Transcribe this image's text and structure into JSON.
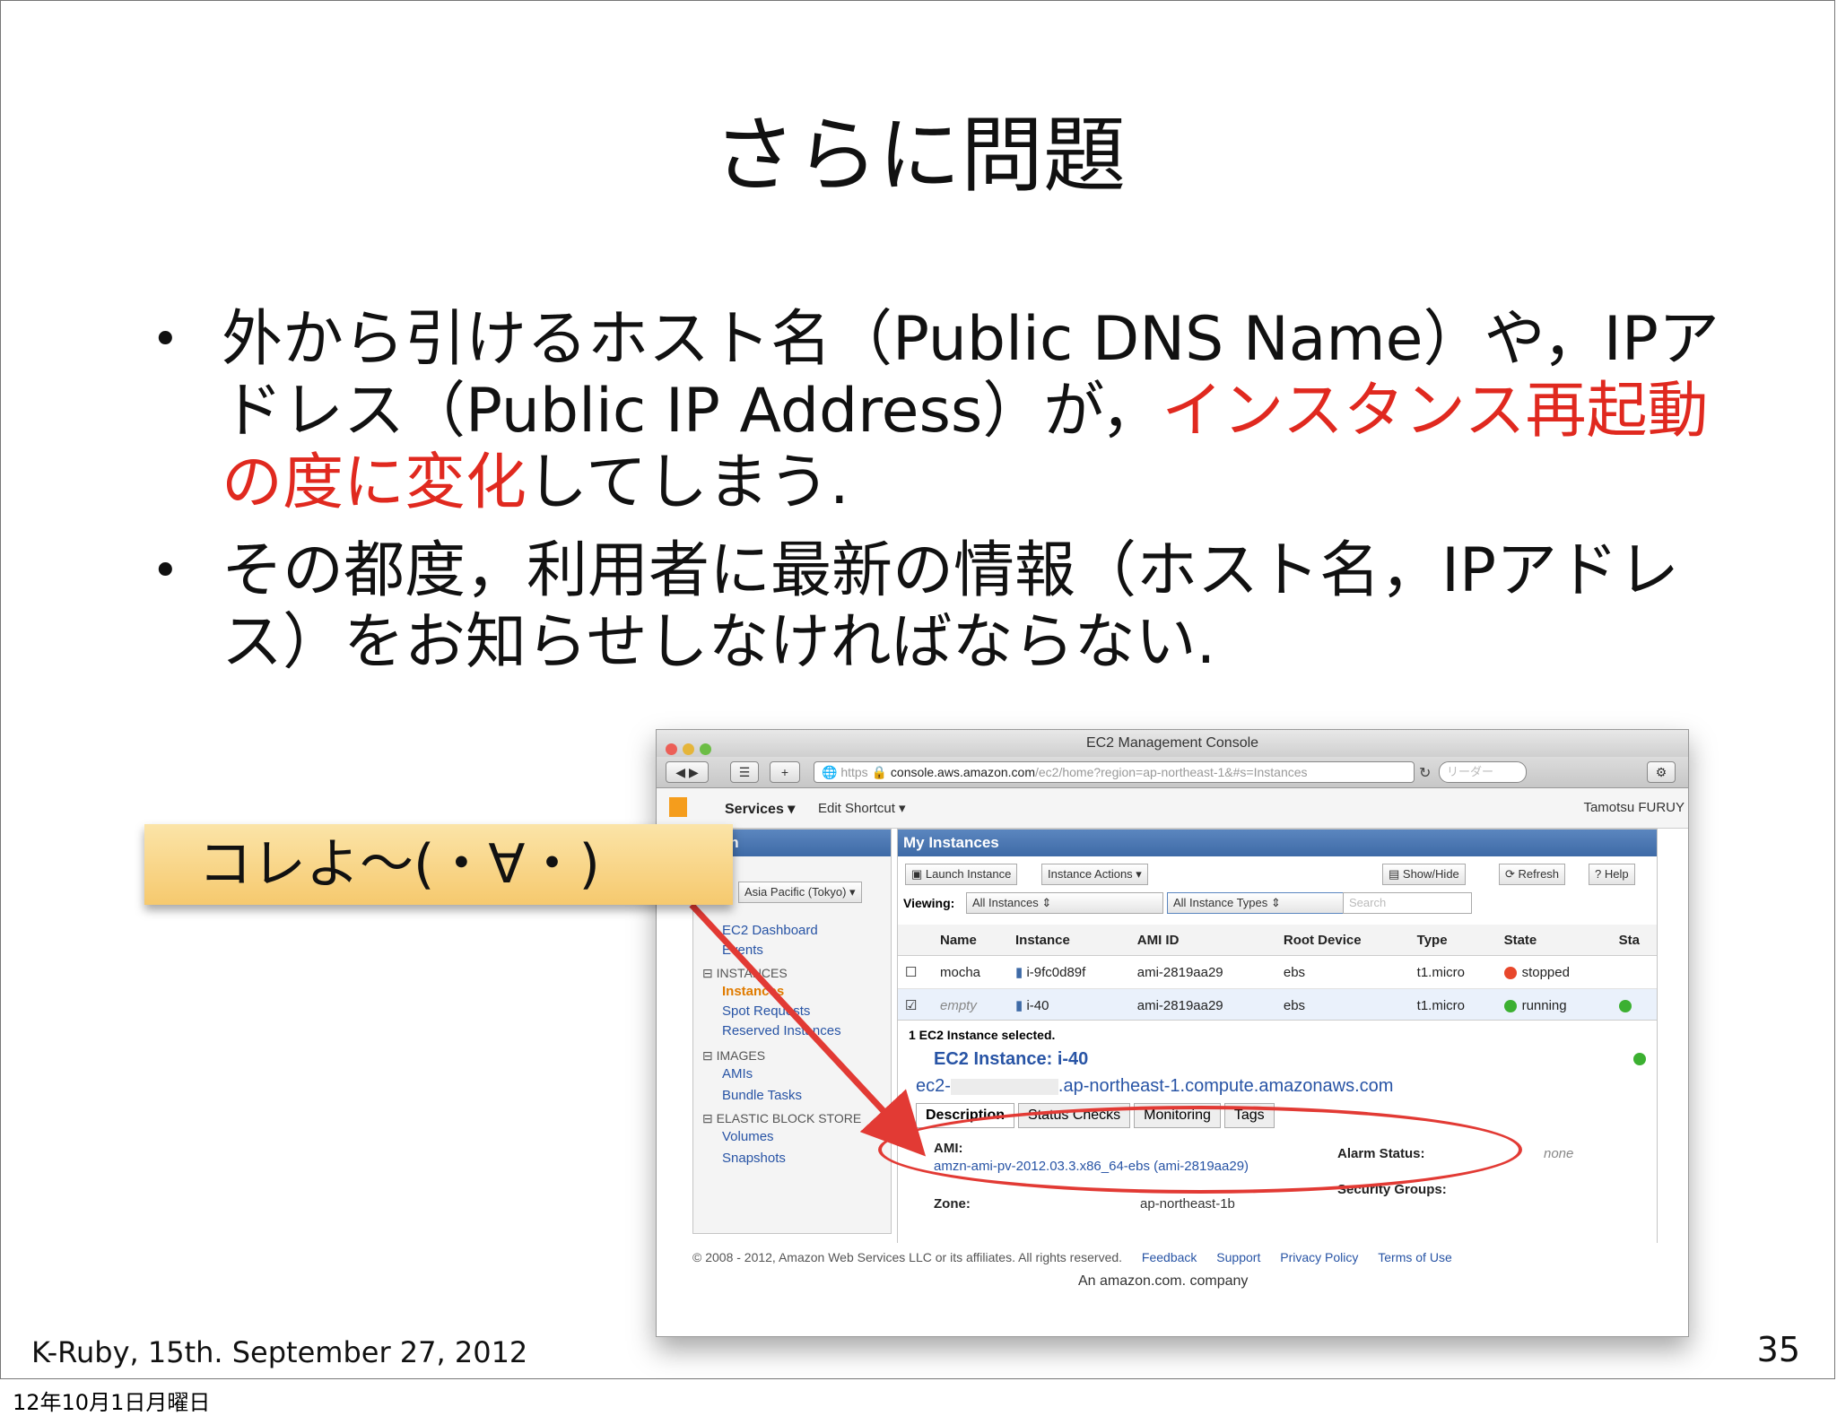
{
  "slide": {
    "title": "さらに問題",
    "bullet_mark": "•",
    "bullet1": {
      "text_a": "外から引けるホスト名（Public DNS Name）や，IPアドレス（Public IP Address）が，",
      "text_red": "インスタンス再起動の度に変化",
      "text_b": "してしまう."
    },
    "bullet2": "その都度，利用者に最新の情報（ホスト名，IPアドレス）をお知らせしなければならない.",
    "footer": "K-Ruby, 15th. September 27, 2012",
    "page_number": "35",
    "date_strip": "12年10月1日月曜日",
    "callout": "コレよ〜(・∀・)",
    "accent_red": "#e0291f"
  },
  "window": {
    "title": "EC2 Management Console",
    "url_scheme": "https",
    "url_host": "console.aws.amazon.com",
    "url_path": "/ec2/home?region=ap-northeast-1&#s=Instances",
    "search_placeholder": "リーダー",
    "services_label": "Services",
    "edit_shortcut_label": "Edit Shortcut",
    "user_label": "Tamotsu FURUY",
    "nav": {
      "header": "ation",
      "region_label": "n:",
      "region_value": "Asia Pacific (Tokyo)",
      "items": [
        "EC2 Dashboard",
        "Events"
      ],
      "sec_instances": "INSTANCES",
      "instances_items": [
        "Instances",
        "Spot Requests",
        "Reserved Instances"
      ],
      "sec_images": "IMAGES",
      "images_items": [
        "AMIs",
        "Bundle Tasks"
      ],
      "sec_ebs": "ELASTIC BLOCK STORE",
      "ebs_items": [
        "Volumes",
        "Snapshots"
      ]
    },
    "main": {
      "header": "My Instances",
      "launch_label": "Launch Instance",
      "actions_label": "Instance Actions",
      "showhide_label": "Show/Hide",
      "refresh_label": "Refresh",
      "help_label": "Help",
      "viewing_label": "Viewing:",
      "viewing_value": "All Instances",
      "types_value": "All Instance Types",
      "search_placeholder": "Search",
      "columns": [
        "Name",
        "Instance",
        "AMI ID",
        "Root Device",
        "Type",
        "State",
        "Sta"
      ],
      "rows": [
        {
          "name": "mocha",
          "instance": "i-9fc0d89f",
          "ami": "ami-2819aa29",
          "root": "ebs",
          "type": "t1.micro",
          "state": "stopped",
          "state_color": "#e8472b"
        },
        {
          "name": "empty",
          "instance": "i-40",
          "ami": "ami-2819aa29",
          "root": "ebs",
          "type": "t1.micro",
          "state": "running",
          "state_color": "#3cb031"
        }
      ],
      "selected_text": "1 EC2 Instance selected.",
      "instance_title": "EC2 Instance: i-40",
      "dns_prefix": "ec2-",
      "dns_suffix": ".ap-northeast-1.compute.amazonaws.com",
      "tabs": [
        "Description",
        "Status Checks",
        "Monitoring",
        "Tags"
      ],
      "ami_label": "AMI:",
      "ami_value": "amzn-ami-pv-2012.03.3.x86_64-ebs (ami-2819aa29)",
      "zone_label": "Zone:",
      "zone_value": "ap-northeast-1b",
      "alarm_label": "Alarm Status:",
      "alarm_value": "none",
      "sg_label": "Security Groups:"
    },
    "footer": {
      "copyright": "© 2008 - 2012, Amazon Web Services LLC or its affiliates. All rights reserved.",
      "links": [
        "Feedback",
        "Support",
        "Privacy Policy",
        "Terms of Use"
      ],
      "company": "An amazon.com. company"
    }
  }
}
